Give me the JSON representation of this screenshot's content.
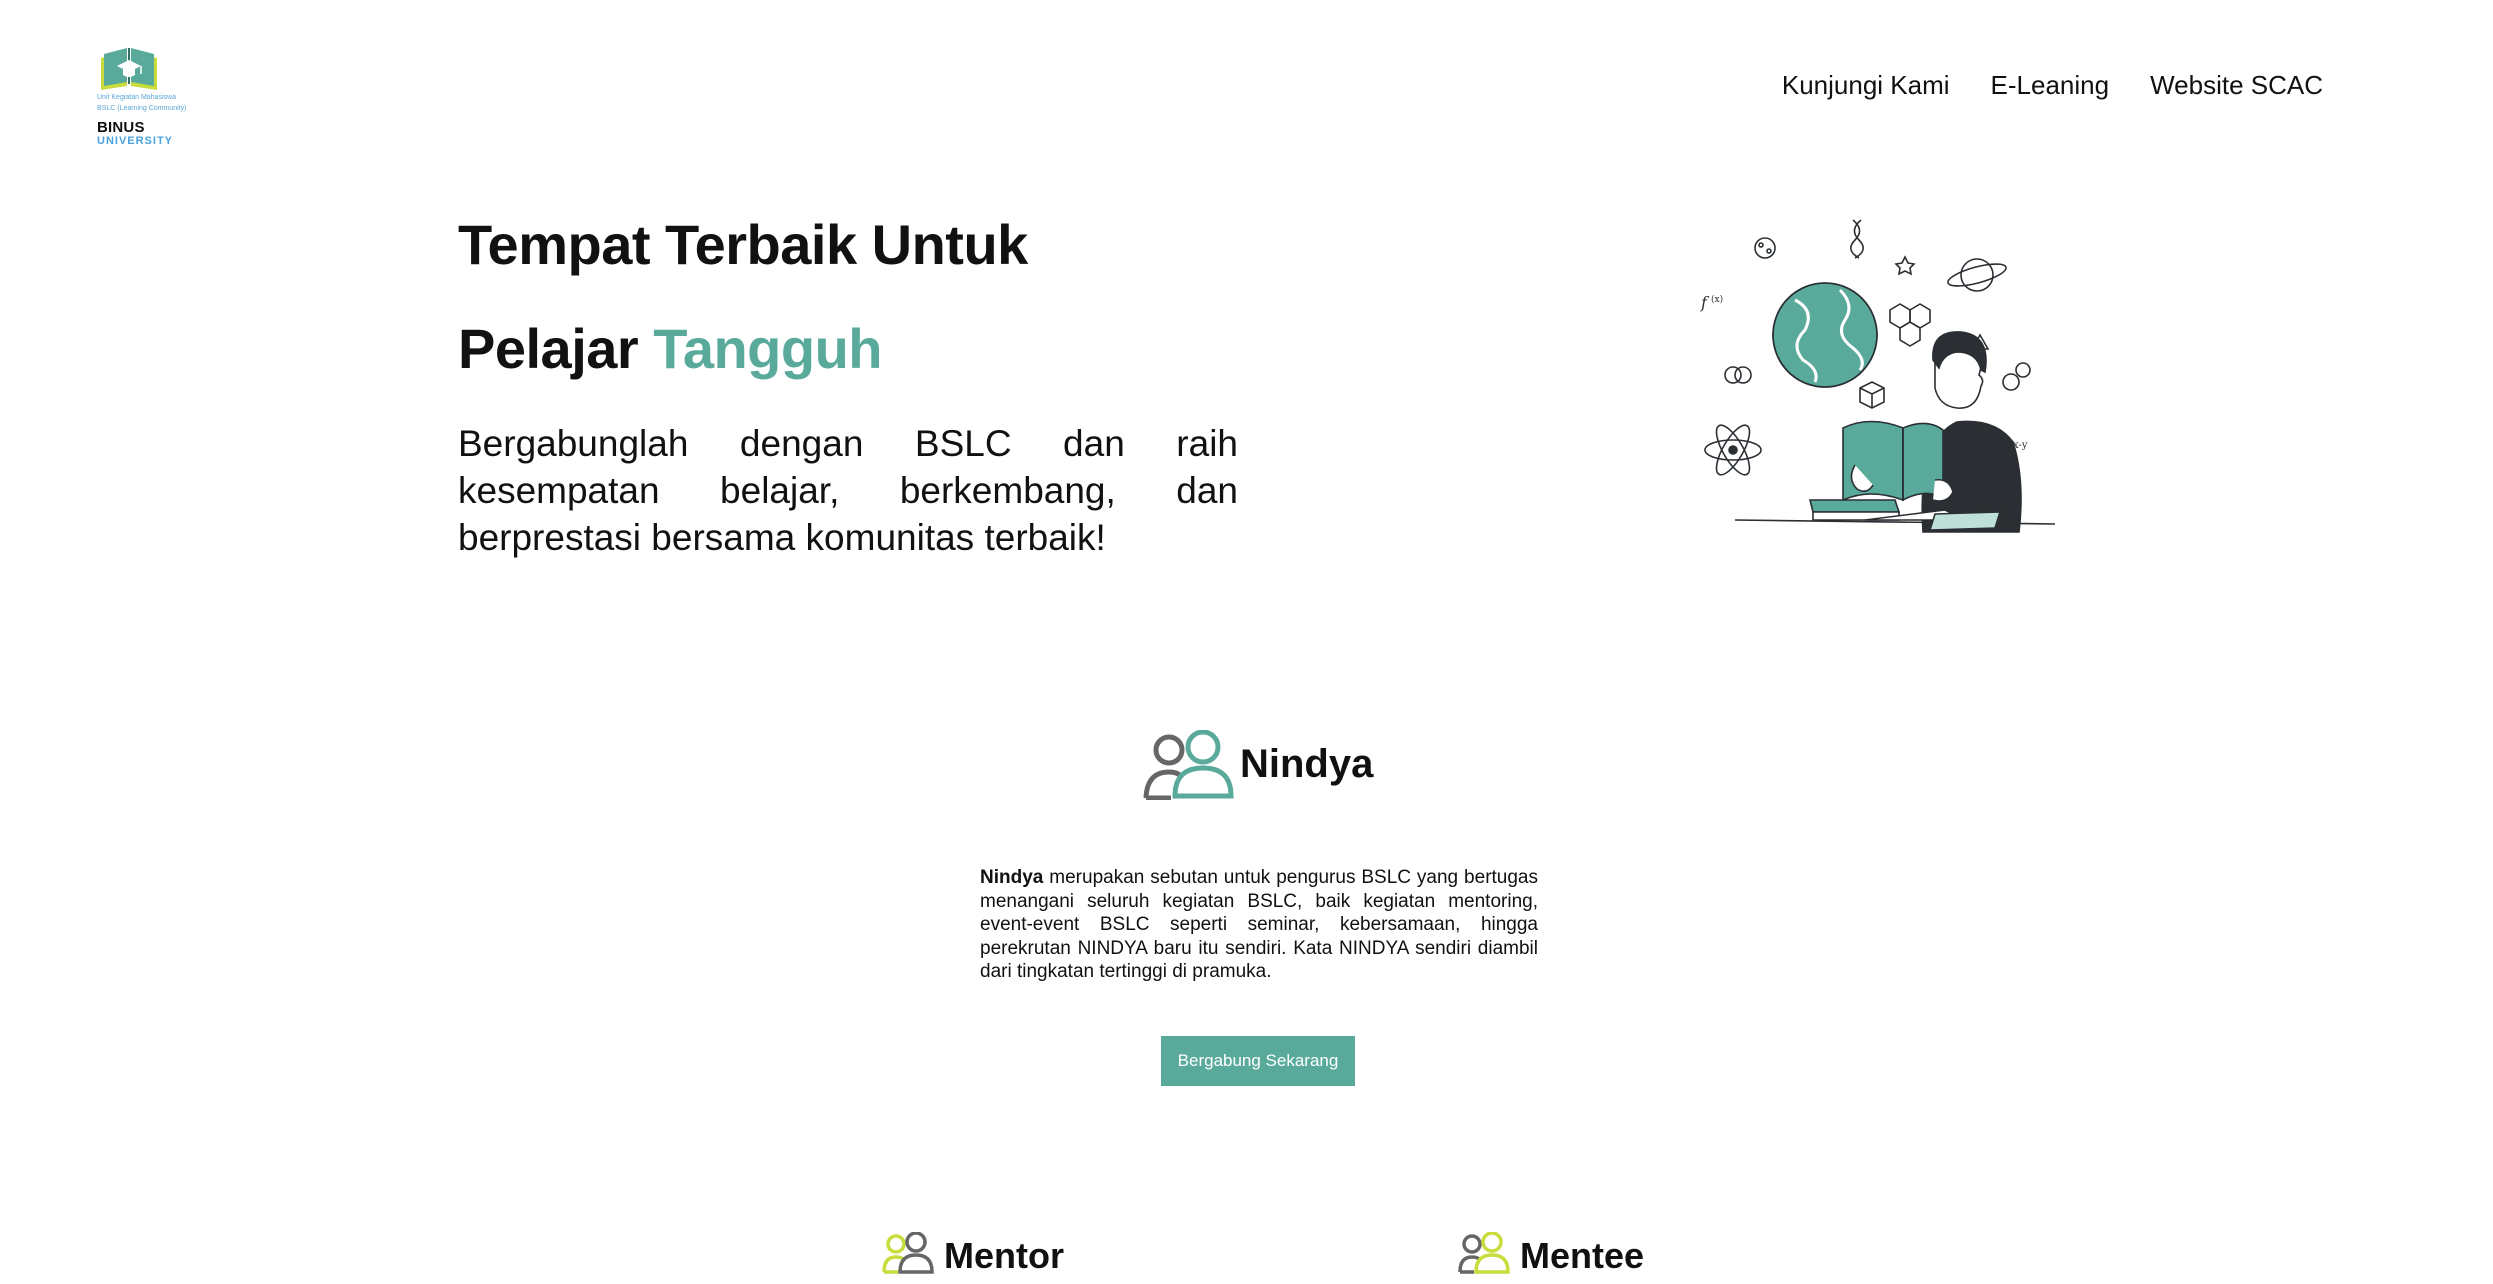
{
  "header": {
    "logo": {
      "sub_line1": "Unit Kegiatan Mahasiswa",
      "sub_line2": "BSLC (Learning Community)",
      "brand": "BINUS",
      "brand_sub": "UNIVERSITY",
      "icon": "open-book-graduation-cap-logo"
    },
    "nav": [
      "Kunjungi Kami",
      "E-Leaning",
      "Website SCAC"
    ]
  },
  "hero": {
    "title_line1": "Tempat Terbaik Untuk",
    "title_line2_plain": "Pelajar ",
    "title_line2_accent": "Tangguh",
    "description": "Bergabunglah dengan BSLC dan raih kesempatan belajar, berkembang, dan berprestasi bersama komunitas terbaik!",
    "illustration": "student-reading-book-with-globe-and-science-icons"
  },
  "nindya": {
    "icon": "people-icon",
    "title": "Nindya",
    "bold_word": "Nindya",
    "text": " merupakan sebutan untuk pengurus BSLC yang bertugas menangani seluruh kegiatan BSLC, baik kegiatan mentoring, event-event BSLC seperti seminar, kebersamaan, hingga perekrutan NINDYA baru itu sendiri. Kata NINDYA sendiri diambil dari tingkatan tertinggi di pramuka.",
    "button": "Bergabung Sekarang"
  },
  "roles": [
    {
      "icon": "people-icon",
      "label": "Mentor"
    },
    {
      "icon": "people-icon",
      "label": "Mentee"
    }
  ],
  "colors": {
    "accent": "#5aaa9c",
    "accent_light": "#c8dc3c",
    "text": "#111111",
    "icon_gray": "#666666",
    "logo_blue": "#4aa3df"
  }
}
